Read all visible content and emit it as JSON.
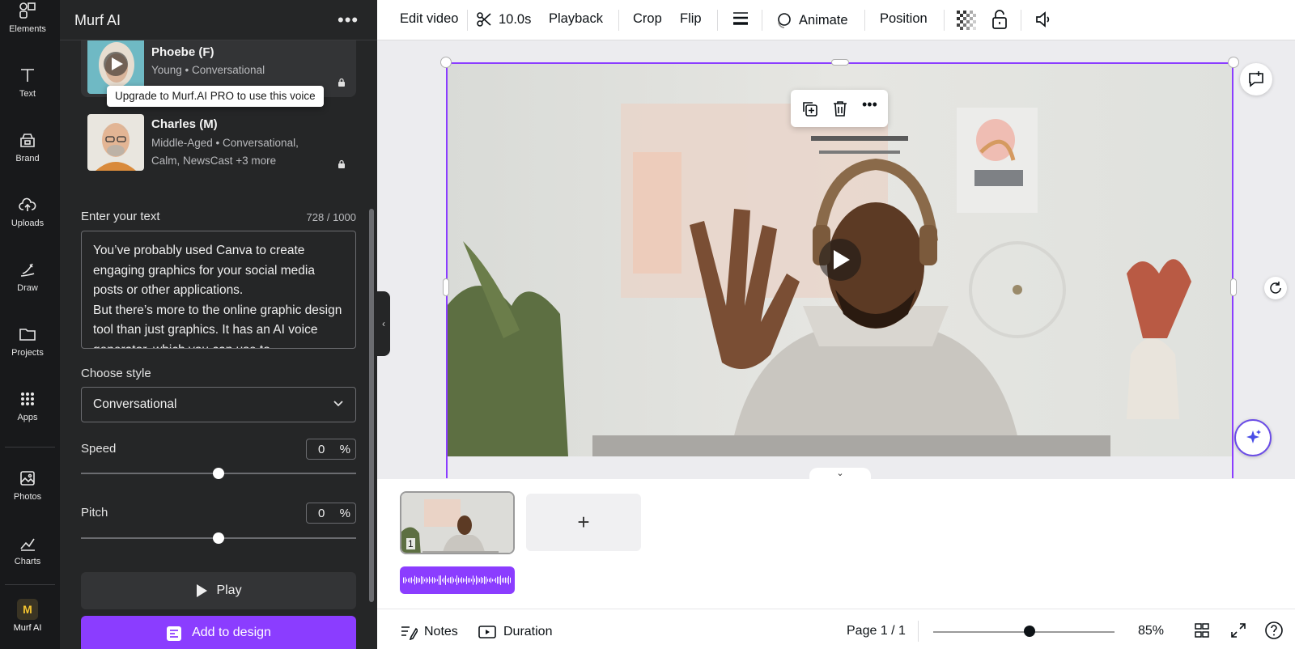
{
  "rail": {
    "items": [
      {
        "label": "Elements",
        "icon": "elements-icon"
      },
      {
        "label": "Text",
        "icon": "text-icon"
      },
      {
        "label": "Brand",
        "icon": "brand-icon"
      },
      {
        "label": "Uploads",
        "icon": "uploads-icon"
      },
      {
        "label": "Draw",
        "icon": "draw-icon"
      },
      {
        "label": "Projects",
        "icon": "folder-icon"
      },
      {
        "label": "Apps",
        "icon": "apps-icon"
      },
      {
        "label": "Photos",
        "icon": "photos-icon"
      },
      {
        "label": "Charts",
        "icon": "charts-icon"
      },
      {
        "label": "Murf AI",
        "icon": "murf-ai-icon"
      }
    ]
  },
  "panel": {
    "title": "Murf AI",
    "voices": [
      {
        "name": "Phoebe (F)",
        "tags": "Young  •  Conversational"
      },
      {
        "name": "Charles (M)",
        "tags": "Middle-Aged  •  Conversational, Calm, NewsCast +3 more"
      }
    ],
    "tooltip": "Upgrade to Murf.AI PRO to use this voice",
    "text_label": "Enter your text",
    "char_count": "728 / 1000",
    "text_value": "You’ve probably used Canva to create engaging graphics for your social media posts or other applications.\nBut there’s more to the online graphic design tool than just graphics. It has an AI voice generator, which you can use to",
    "style_label": "Choose style",
    "style_value": "Conversational",
    "speed_label": "Speed",
    "speed_value": "0",
    "pitch_label": "Pitch",
    "pitch_value": "0",
    "unit": "%",
    "play_label": "Play",
    "add_label": "Add to design"
  },
  "toolbar": {
    "edit_video": "Edit video",
    "duration": "10.0s",
    "playback": "Playback",
    "crop": "Crop",
    "flip": "Flip",
    "animate": "Animate",
    "position": "Position"
  },
  "timeline": {
    "page_number": "1",
    "add_page": "+"
  },
  "footer": {
    "notes": "Notes",
    "duration": "Duration",
    "page": "Page 1 / 1",
    "zoom": "85%",
    "zoom_level": 0.53
  },
  "colors": {
    "accent": "#8b3dff",
    "rail_bg": "#18191b",
    "panel_bg": "#252627"
  }
}
